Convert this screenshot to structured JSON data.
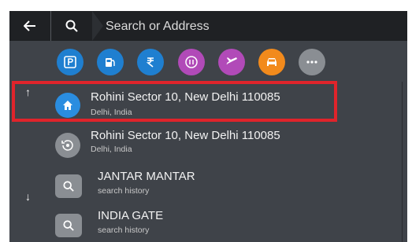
{
  "search": {
    "placeholder": "Search or Address"
  },
  "categories": [
    {
      "icon": "parking-icon",
      "color": "#1f7fd0"
    },
    {
      "icon": "fuel-icon",
      "color": "#1f7fd0"
    },
    {
      "icon": "atm-rupee-icon",
      "color": "#1f7fd0"
    },
    {
      "icon": "emergency-icon",
      "color": "#b14ab8"
    },
    {
      "icon": "airport-icon",
      "color": "#b14ab8"
    },
    {
      "icon": "car-icon",
      "color": "#f28a1c"
    },
    {
      "icon": "more-icon",
      "color": "#8a8e93"
    }
  ],
  "results": [
    {
      "type": "home",
      "title": "Rohini Sector 10, New Delhi 110085",
      "subtitle": "Delhi, India"
    },
    {
      "type": "recent",
      "title": "Rohini Sector 10, New Delhi 110085",
      "subtitle": "Delhi, India"
    },
    {
      "type": "history",
      "title": "JANTAR MANTAR",
      "subtitle": "search history"
    },
    {
      "type": "history",
      "title": "INDIA GATE",
      "subtitle": "search history"
    }
  ],
  "arrows": {
    "up": "↑",
    "down": "↓"
  },
  "colors": {
    "highlight": "#e0242b",
    "topbar": "#1f2124",
    "panel": "#3f4349",
    "home_icon": "#2a8de0"
  }
}
